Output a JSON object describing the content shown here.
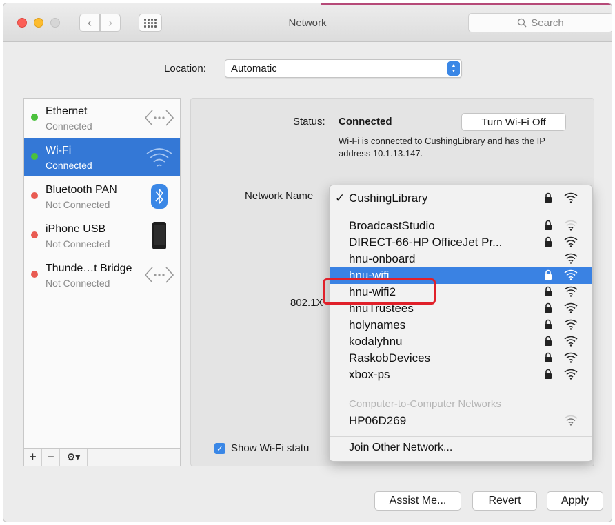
{
  "window": {
    "title": "Network",
    "search_placeholder": "Search"
  },
  "location": {
    "label": "Location:",
    "value": "Automatic"
  },
  "sidebar": {
    "services": [
      {
        "name": "Ethernet",
        "status": "Connected",
        "dot": "#4bc13d",
        "icon": "ethernet-icon"
      },
      {
        "name": "Wi-Fi",
        "status": "Connected",
        "dot": "#4bc13d",
        "icon": "wifi-icon",
        "selected": true
      },
      {
        "name": "Bluetooth PAN",
        "status": "Not Connected",
        "dot": "#e95b52",
        "icon": "bluetooth-icon"
      },
      {
        "name": "iPhone USB",
        "status": "Not Connected",
        "dot": "#e95b52",
        "icon": "iphone-icon"
      },
      {
        "name": "Thunde…t Bridge",
        "status": "Not Connected",
        "dot": "#e95b52",
        "icon": "thunderbolt-bridge-icon"
      }
    ],
    "footer": {
      "add": "+",
      "remove": "−"
    }
  },
  "detail": {
    "status_label": "Status:",
    "status_value": "Connected",
    "turn_off_label": "Turn Wi-Fi Off",
    "status_desc": "Wi-Fi is connected to CushingLibrary and has the IP address 10.1.13.147.",
    "network_name_label": "Network Name",
    "dot1x_label": "802.1X",
    "show_wifi_label": "Show Wi-Fi statu"
  },
  "menu": {
    "current": "CushingLibrary",
    "networks": [
      {
        "name": "BroadcastStudio",
        "locked": true,
        "signal": 1
      },
      {
        "name": "DIRECT-66-HP OfficeJet Pr...",
        "locked": true,
        "signal": 3
      },
      {
        "name": "hnu-onboard",
        "locked": false,
        "signal": 3
      },
      {
        "name": "hnu-wifi",
        "locked": true,
        "signal": 3,
        "highlighted": true
      },
      {
        "name": "hnu-wifi2",
        "locked": true,
        "signal": 3
      },
      {
        "name": "hnuTrustees",
        "locked": true,
        "signal": 3
      },
      {
        "name": "holynames",
        "locked": true,
        "signal": 3
      },
      {
        "name": "kodalyhnu",
        "locked": true,
        "signal": 3
      },
      {
        "name": "RaskobDevices",
        "locked": true,
        "signal": 3
      },
      {
        "name": "xbox-ps",
        "locked": true,
        "signal": 3
      }
    ],
    "c2c_header": "Computer-to-Computer Networks",
    "c2c_networks": [
      {
        "name": "HP06D269",
        "locked": false,
        "signal": 2
      }
    ],
    "join_other": "Join Other Network..."
  },
  "buttons": {
    "assist": "Assist Me...",
    "revert": "Revert",
    "apply": "Apply"
  },
  "colors": {
    "accent": "#3478d6",
    "highlight_box": "#e0202a"
  }
}
